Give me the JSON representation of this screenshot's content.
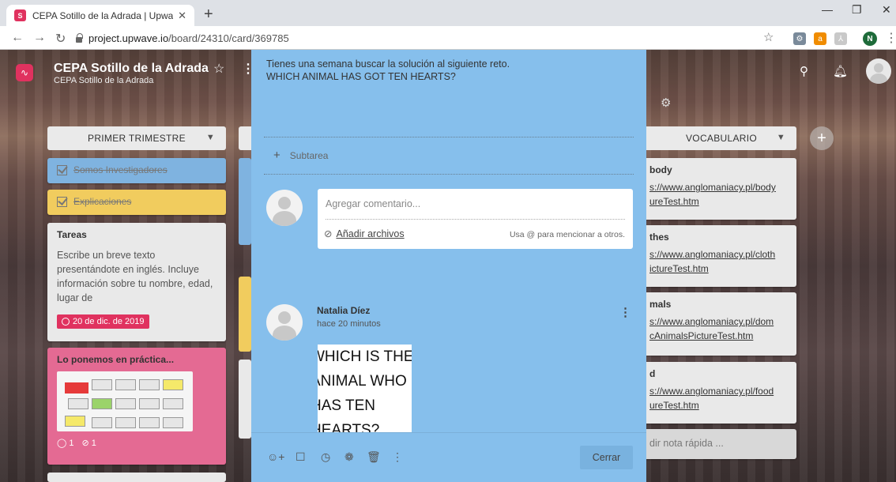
{
  "browser": {
    "tab_title": "CEPA Sotillo de la Adrada | Upwave",
    "favicon_letter": "S",
    "url_domain": "project.upwave.io",
    "url_path": "/board/24310/card/369785",
    "new_tab": "+",
    "profile_initial": "N"
  },
  "board": {
    "title": "CEPA Sotillo de la Adrada",
    "subtitle": "CEPA Sotillo de la Adrada"
  },
  "columns": {
    "first": {
      "header": "PRIMER TRIMESTRE",
      "cards": {
        "done1": "Somos Investigadores",
        "done2": "Explicaciones",
        "tareas_title": "Tareas",
        "tareas_text": "Escribe un breve texto presentándote en inglés. Incluye información sobre tu nombre, edad, lugar de",
        "tareas_date": "20 de dic. de 2019",
        "practica_title": "Lo ponemos en práctica...",
        "practica_comments": "1",
        "practica_attachments": "1"
      }
    },
    "vocab": {
      "header": "VOCABULARIO",
      "card1_title": "body",
      "card1_link": "s://www.anglomaniacy.pl/body\nureTest.htm",
      "card2_title": "thes",
      "card2_link": "s://www.anglomaniacy.pl/cloth\nictureTest.htm",
      "card3_title": "mals",
      "card3_link": "s://www.anglomaniacy.pl/dom\ncAnimalsPictureTest.htm",
      "card4_title": "d",
      "card4_link": "s://www.anglomaniacy.pl/food\nureTest.htm",
      "quick_note": "dir nota rápida ..."
    }
  },
  "modal": {
    "description_line1": "Tienes una semana buscar la solución al siguiente reto.",
    "description_line2": "WHICH ANIMAL HAS GOT TEN HEARTS?",
    "subtask_label": "Subtarea",
    "comment_placeholder": "Agregar comentario...",
    "attach_label": "Añadir archivos",
    "mention_hint": "Usa @ para mencionar a otros.",
    "comment": {
      "author": "Natalia Díez",
      "time": "hace 20 minutos",
      "image_lines": [
        "WHICH IS THE",
        "ANIMAL WHO",
        "HAS TEN",
        "HEARTS?"
      ]
    },
    "close_label": "Cerrar"
  },
  "colors": {
    "modal_bg": "#86bfec",
    "accent": "#e0325f"
  }
}
